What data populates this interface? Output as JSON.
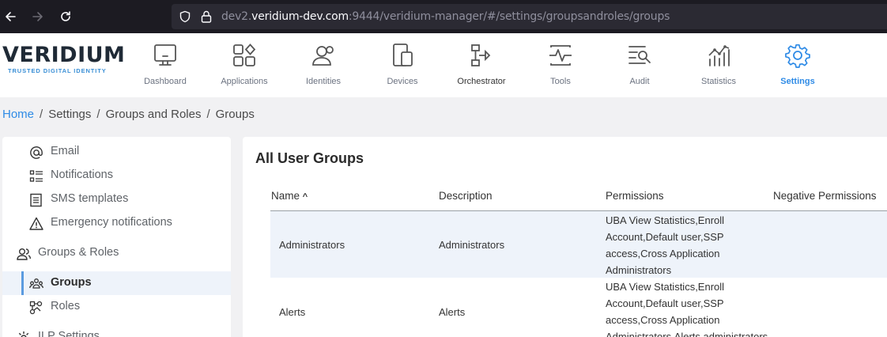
{
  "browser": {
    "url_prefix": "dev2.",
    "url_domain": "veridium-dev.com",
    "url_suffix": ":9444/veridium-manager/#/settings/groupsandroles/groups"
  },
  "logo": {
    "word": "VERIDIUM",
    "tagline": "TRUSTED DIGITAL IDENTITY"
  },
  "nav": [
    {
      "label": "Dashboard",
      "icon": "monitor-icon"
    },
    {
      "label": "Applications",
      "icon": "apps-grid-icon"
    },
    {
      "label": "Identities",
      "icon": "users-icon"
    },
    {
      "label": "Devices",
      "icon": "devices-icon"
    },
    {
      "label": "Orchestrator",
      "icon": "orchestrator-icon"
    },
    {
      "label": "Tools",
      "icon": "tools-icon"
    },
    {
      "label": "Audit",
      "icon": "audit-icon"
    },
    {
      "label": "Statistics",
      "icon": "statistics-icon"
    },
    {
      "label": "Settings",
      "icon": "gear-icon",
      "active": true
    }
  ],
  "breadcrumb": [
    "Home",
    "Settings",
    "Groups and Roles",
    "Groups"
  ],
  "sidebar": {
    "items": [
      {
        "label": "Email",
        "icon": "at-icon"
      },
      {
        "label": "Notifications",
        "icon": "list-icon"
      },
      {
        "label": "SMS templates",
        "icon": "document-icon"
      },
      {
        "label": "Emergency notifications",
        "icon": "warning-icon"
      },
      {
        "label": "Groups & Roles",
        "icon": "people-icon"
      },
      {
        "label": "Groups",
        "icon": "group-icon",
        "active": true
      },
      {
        "label": "Roles",
        "icon": "roles-icon"
      },
      {
        "label": "ILP Settings",
        "icon": "settings-icon"
      }
    ]
  },
  "main": {
    "title": "All User Groups",
    "columns": [
      "Name",
      "Description",
      "Permissions",
      "Negative Permissions"
    ],
    "sort_indicator": "^",
    "rows": [
      {
        "name": "Administrators",
        "description": "Administrators",
        "permissions": [
          "UBA View Statistics,Enroll",
          "Account,Default user,SSP",
          "access,Cross Application",
          "Administrators"
        ],
        "negative_permissions": ""
      },
      {
        "name": "Alerts",
        "description": "Alerts",
        "permissions": [
          "UBA View Statistics,Enroll",
          "Account,Default user,SSP",
          "access,Cross Application",
          "Administrators,Alerts administrators"
        ],
        "negative_permissions": ""
      }
    ]
  },
  "colors": {
    "accent": "#2f8be6",
    "row_highlight": "#eef3fa",
    "browser_bg": "#1c1b22"
  }
}
